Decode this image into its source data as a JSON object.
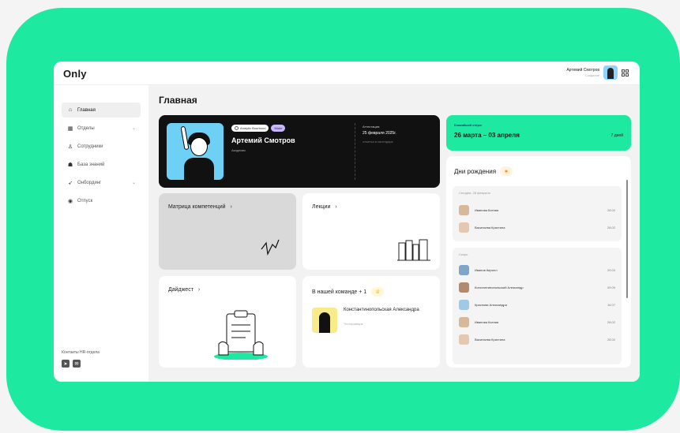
{
  "app": {
    "logo": "Only"
  },
  "user": {
    "name": "Артемий Смотров",
    "role": "Создание"
  },
  "sidebar": {
    "items": [
      {
        "label": "Главная",
        "icon": "home-icon"
      },
      {
        "label": "Отделы",
        "icon": "grid-icon"
      },
      {
        "label": "Сотрудники",
        "icon": "people-icon"
      },
      {
        "label": "База знаний",
        "icon": "graduation-icon"
      },
      {
        "label": "Онбординг",
        "icon": "rocket-icon"
      },
      {
        "label": "Отпуск",
        "icon": "vacation-icon"
      }
    ],
    "contacts": "Контакты HR-отдела"
  },
  "main": {
    "title": "Главная"
  },
  "profile": {
    "badge1": "Analytic Bourbond",
    "badge2": "Made",
    "name": "Артемий Смотров",
    "role": "Академик",
    "attestation_label": "Аттестация:",
    "attestation_date": "25 февраля 2025г.",
    "attestation_sub": "отметка в календарь"
  },
  "vacation": {
    "label": "Ближайший отпуск",
    "dates": "26 марта – 03 апреля",
    "days": "7 дней"
  },
  "cards": {
    "matrix": "Матрица компетенций",
    "lectures": "Лекции",
    "digest": "Дайджест",
    "team": "В нашей команде + 1",
    "team_member": "Константинопольская Александра",
    "team_member_role": "Тестировщик"
  },
  "birthdays": {
    "title": "Дни рождения",
    "today_label": "Сегодня, 28 февраля",
    "today": [
      {
        "name": "Иванова Ксения",
        "date": "28.02"
      },
      {
        "name": "Васильева Кристина",
        "date": "28.02"
      }
    ],
    "soon_label": "Скоро",
    "soon": [
      {
        "name": "Иванов Кирилл",
        "date": "29.03"
      },
      {
        "name": "Константинопольский Александр",
        "date": "09.09"
      },
      {
        "name": "Краснова Александра",
        "date": "16.07"
      },
      {
        "name": "Иванова Ксения",
        "date": "28.02"
      },
      {
        "name": "Васильева Кристина",
        "date": "28.02"
      }
    ]
  },
  "colors": {
    "accent": "#1de9a0",
    "dark_card": "#111111",
    "badge_purple": "#c9b6ff"
  }
}
